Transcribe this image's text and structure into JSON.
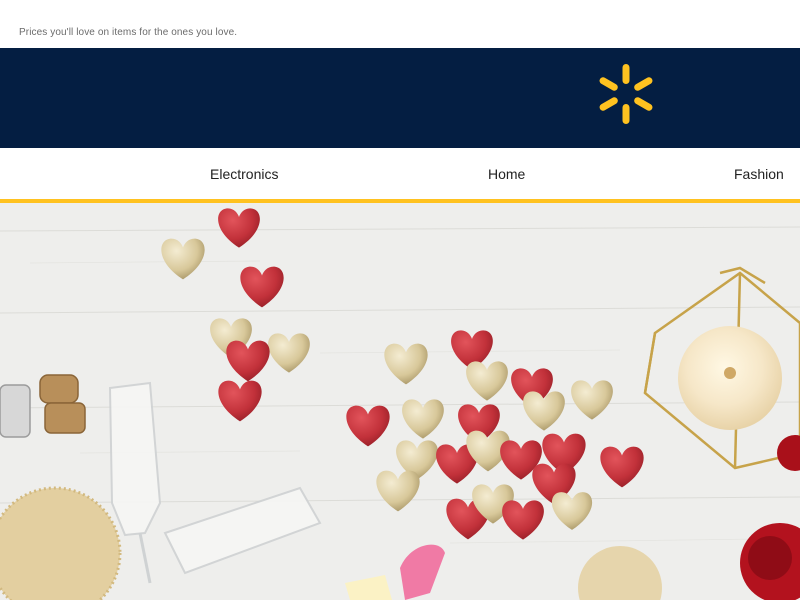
{
  "preheader": {
    "text": "Prices you'll love on items for the ones you love."
  },
  "brand": {
    "logo_icon": "spark-icon",
    "bar_color": "#041e42",
    "spark_color": "#ffc220"
  },
  "nav": {
    "accent_color": "#ffc220",
    "items": [
      {
        "label": "Electronics"
      },
      {
        "label": "Home"
      },
      {
        "label": "Fashion"
      }
    ]
  },
  "hero": {
    "image_subject": "valentine-chocolate-hearts-candle-champagne",
    "colors": {
      "table": "#eeeeec",
      "red_foil": "#c2313a",
      "gold_foil": "#d8c89a",
      "candle": "#fbf3e3",
      "rose": "#b3121e"
    }
  }
}
